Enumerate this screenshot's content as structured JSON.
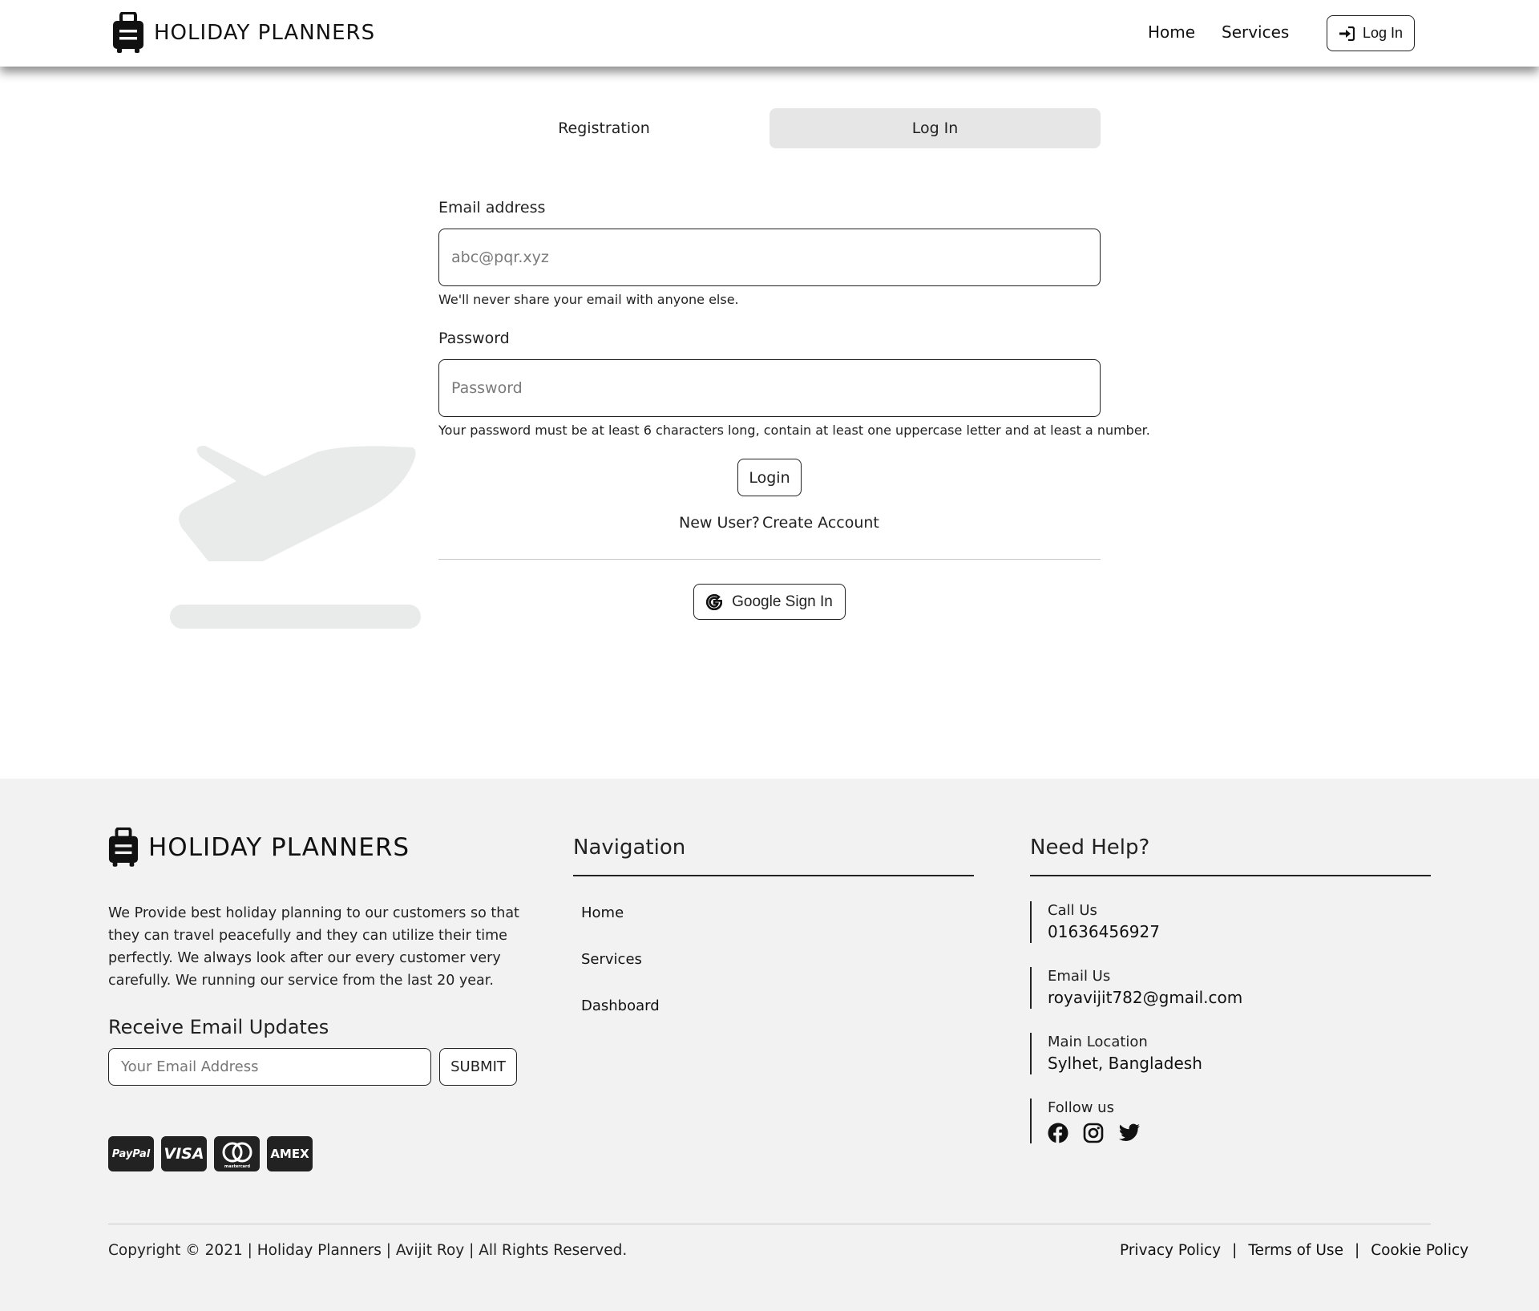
{
  "header": {
    "brand": "HOLIDAY PLANNERS",
    "nav": [
      {
        "label": "Home"
      },
      {
        "label": "Services"
      }
    ],
    "login_button": "Log In"
  },
  "tabs": [
    {
      "label": "Registration",
      "active": false
    },
    {
      "label": "Log In",
      "active": true
    }
  ],
  "form": {
    "email_label": "Email address",
    "email_placeholder": "abc@pqr.xyz",
    "email_help": "We'll never share your email with anyone else.",
    "password_label": "Password",
    "password_placeholder": "Password",
    "password_help": "Your password must be at least 6 characters long, contain at least one uppercase letter and at least a number.",
    "submit_label": "Login",
    "new_user": "New User?",
    "create_account": "Create Account",
    "google_label": "Google Sign In"
  },
  "footer": {
    "brand": "HOLIDAY PLANNERS",
    "about": "We Provide best holiday planning to our customers so that they can travel peacefully and they can utilize their time perfectly. We always look after our every customer very carefully. We running our service from the last 20 year.",
    "updates_heading": "Receive Email Updates",
    "email_placeholder": "Your Email Address",
    "submit_label": "SUBMIT",
    "payments": [
      {
        "name": "paypal-icon",
        "label": "PayPal"
      },
      {
        "name": "visa-icon",
        "label": "VISA"
      },
      {
        "name": "mastercard-icon",
        "label": "mastercard"
      },
      {
        "name": "amex-icon",
        "label": "AMEX"
      }
    ],
    "navigation_heading": "Navigation",
    "navigation": [
      {
        "label": "Home"
      },
      {
        "label": "Services"
      },
      {
        "label": "Dashboard"
      }
    ],
    "help_heading": "Need Help?",
    "contacts": [
      {
        "label": "Call Us",
        "value": "01636456927"
      },
      {
        "label": "Email Us",
        "value": "royavijit782@gmail.com"
      },
      {
        "label": "Main Location",
        "value": "Sylhet, Bangladesh"
      }
    ],
    "follow_label": "Follow us",
    "social": [
      "facebook-icon",
      "instagram-icon",
      "twitter-icon"
    ],
    "copyright": "Copyright © 2021 | Holiday Planners | Avijit Roy | All Rights Reserved.",
    "policies": [
      {
        "label": "Privacy Policy"
      },
      {
        "label": "Terms of Use"
      },
      {
        "label": "Cookie Policy"
      }
    ]
  }
}
